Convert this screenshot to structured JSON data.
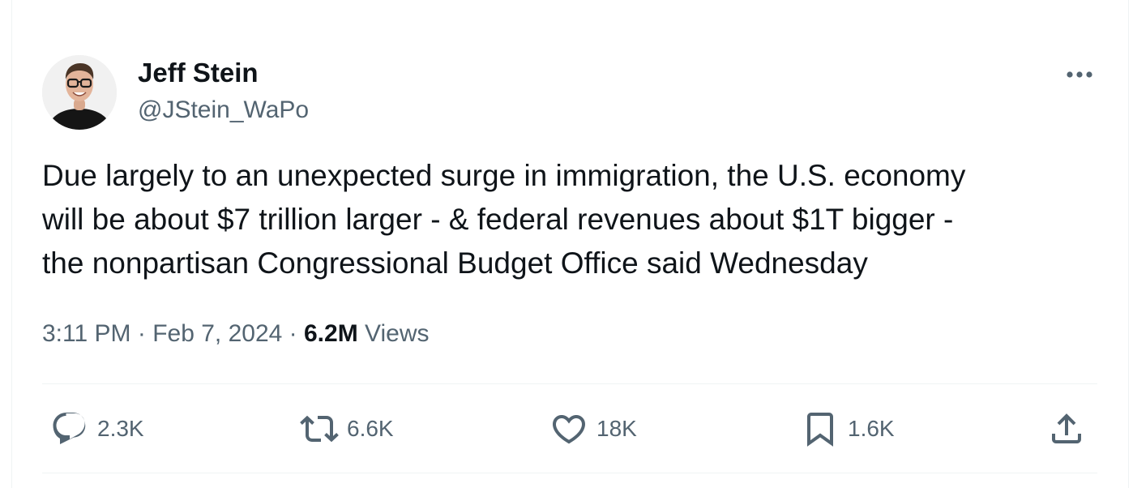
{
  "tweet": {
    "author": {
      "name": "Jeff Stein",
      "handle": "@JStein_WaPo"
    },
    "text_lines": [
      "Due largely to an unexpected surge in immigration, the U.S. economy",
      "will be about $7 trillion larger - & federal revenues about $1T bigger -",
      "the nonpartisan Congressional Budget Office said Wednesday"
    ],
    "time": "3:11 PM",
    "separator": "·",
    "date": "Feb 7, 2024",
    "views_count": "6.2M",
    "views_label": "Views"
  },
  "actions": {
    "replies": {
      "icon": "reply-icon",
      "count": "2.3K"
    },
    "reposts": {
      "icon": "repost-icon",
      "count": "6.6K"
    },
    "likes": {
      "icon": "heart-icon",
      "count": "18K"
    },
    "bookmarks": {
      "icon": "bookmark-icon",
      "count": "1.6K"
    },
    "share": {
      "icon": "share-icon"
    }
  },
  "more_menu": {
    "icon": "more-dots-icon"
  },
  "colors": {
    "text_primary": "#0f1419",
    "text_secondary": "#536471",
    "divider": "#eff3f4",
    "background": "#ffffff"
  }
}
